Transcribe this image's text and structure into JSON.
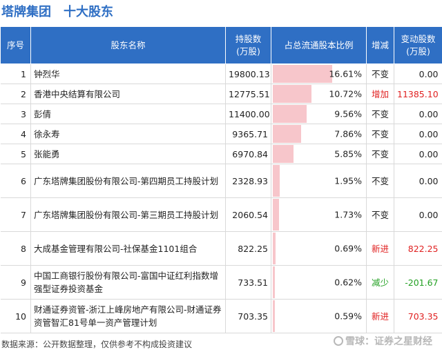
{
  "title": {
    "company": "塔牌集团",
    "subject": "十大股东"
  },
  "table": {
    "headers": {
      "index": "序号",
      "name": "股东名称",
      "shares": "持股数\n(万股)",
      "ratio": "占总流通股本比例",
      "change": "增减",
      "delta": "变动股数\n(万股)"
    },
    "max_ratio": 16.61,
    "rows": [
      {
        "index": "1",
        "name": "钟烈华",
        "shares": "19800.13",
        "ratio": 16.61,
        "ratio_text": "16.61%",
        "change": "不变",
        "delta": "0.00",
        "delta_sign": "zero",
        "height": 29
      },
      {
        "index": "2",
        "name": "香港中央结算有限公司",
        "shares": "12775.51",
        "ratio": 10.72,
        "ratio_text": "10.72%",
        "change": "增加",
        "delta": "11385.10",
        "delta_sign": "pos",
        "height": 29
      },
      {
        "index": "3",
        "name": "彭倩",
        "shares": "11400.00",
        "ratio": 9.56,
        "ratio_text": "9.56%",
        "change": "不变",
        "delta": "0.00",
        "delta_sign": "zero",
        "height": 29
      },
      {
        "index": "4",
        "name": "徐永寿",
        "shares": "9365.71",
        "ratio": 7.86,
        "ratio_text": "7.86%",
        "change": "不变",
        "delta": "0.00",
        "delta_sign": "zero",
        "height": 29
      },
      {
        "index": "5",
        "name": "张能勇",
        "shares": "6970.84",
        "ratio": 5.85,
        "ratio_text": "5.85%",
        "change": "不变",
        "delta": "0.00",
        "delta_sign": "zero",
        "height": 29
      },
      {
        "index": "6",
        "name": "广东塔牌集团股份有限公司-第四期员工持股计划",
        "shares": "2328.93",
        "ratio": 1.95,
        "ratio_text": "1.95%",
        "change": "不变",
        "delta": "0.00",
        "delta_sign": "zero",
        "height": 49
      },
      {
        "index": "7",
        "name": "广东塔牌集团股份有限公司-第三期员工持股计划",
        "shares": "2060.54",
        "ratio": 1.73,
        "ratio_text": "1.73%",
        "change": "不变",
        "delta": "0.00",
        "delta_sign": "zero",
        "height": 49
      },
      {
        "index": "8",
        "name": "大成基金管理有限公司-社保基金1101组合",
        "shares": "822.25",
        "ratio": 0.69,
        "ratio_text": "0.69%",
        "change": "新进",
        "delta": "822.25",
        "delta_sign": "pos",
        "height": 49
      },
      {
        "index": "9",
        "name": "中国工商银行股份有限公司-富国中证红利指数增强型证券投资基金",
        "shares": "733.51",
        "ratio": 0.62,
        "ratio_text": "0.62%",
        "change": "减少",
        "delta": "-201.67",
        "delta_sign": "neg",
        "height": 49
      },
      {
        "index": "10",
        "name": "财通证券资管-浙江上峰房地产有限公司-财通证券资管智汇81号单一资产管理计划",
        "shares": "703.35",
        "ratio": 0.59,
        "ratio_text": "0.59%",
        "change": "新进",
        "delta": "703.35",
        "delta_sign": "pos",
        "height": 49
      }
    ]
  },
  "footer": {
    "source": "数据来源：公开数据整理，仅供参考不构成投资建议"
  },
  "watermark": {
    "text": "雪球：证券之星财经",
    "icon": "snowball-logo-icon"
  },
  "colors": {
    "header_bg": "#2f6fc4",
    "bar": "#f7c6cb",
    "increase": "#e02020",
    "decrease": "#22a022"
  }
}
